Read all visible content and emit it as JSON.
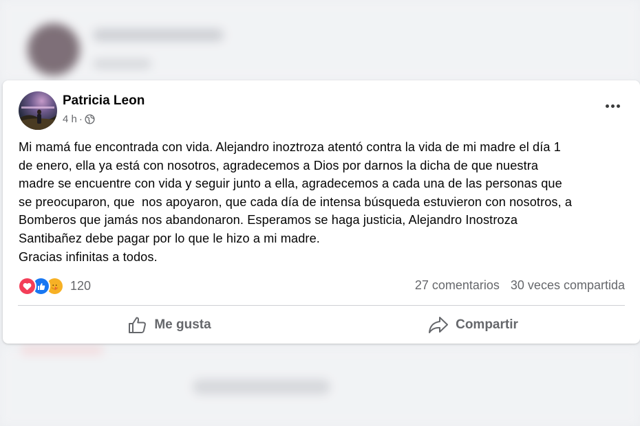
{
  "post": {
    "author": "Patricia Leon",
    "time": "4 h",
    "separator": "·",
    "privacy_icon": "globe-icon",
    "more_icon": "more-options-icon",
    "text_lines": [
      "Mi mamá fue encontrada con vida. Alejandro inoztroza atentó contra la vida de mi madre el día 1",
      "de enero, ella ya está con nosotros, agradecemos a Dios por darnos la dicha de que nuestra",
      "madre se encuentre con vida y seguir junto a ella, agradecemos a cada una de las personas que",
      "se preocuparon, que  nos apoyaron, que cada día de intensa búsqueda estuvieron con nosotros, a",
      "Bomberos que jamás nos abandonaron. Esperamos se haga justicia, Alejandro Inostroza",
      "Santibañez debe pagar por lo que le hizo a mi madre.",
      "Gracias infinitas a todos."
    ],
    "reactions": {
      "icons": [
        "love-reaction-icon",
        "like-reaction-icon",
        "care-reaction-icon"
      ],
      "count": "120"
    },
    "comments": "27 comentarios",
    "shares": "30 veces compartida",
    "actions": {
      "like_label": "Me gusta",
      "share_label": "Compartir"
    }
  },
  "colors": {
    "love": "#f33e58",
    "like": "#1877f2",
    "care": "#f7b125",
    "secondary_text": "#65676b"
  }
}
